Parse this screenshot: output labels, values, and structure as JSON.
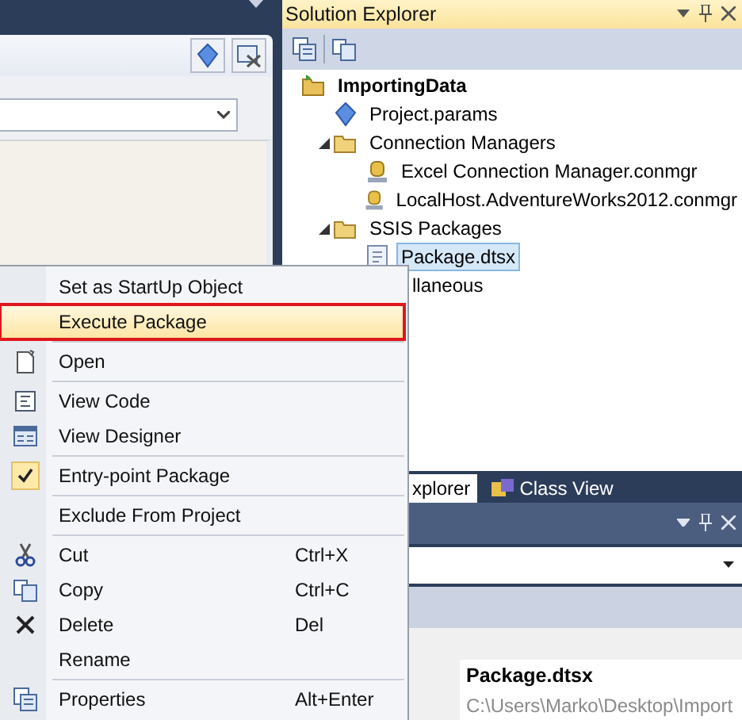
{
  "solution_explorer": {
    "title": "Solution Explorer",
    "tree": [
      {
        "label": "ImportingData",
        "kind": "project",
        "bold": true,
        "selected": false,
        "children": [
          {
            "label": "Project.params",
            "kind": "params",
            "selected": false
          },
          {
            "label": "Connection Managers",
            "kind": "folder",
            "expanded": true,
            "selected": false,
            "children": [
              {
                "label": "Excel Connection Manager.conmgr",
                "kind": "connection",
                "selected": false
              },
              {
                "label": "LocalHost.AdventureWorks2012.conmgr",
                "kind": "connection",
                "selected": false
              }
            ]
          },
          {
            "label": "SSIS Packages",
            "kind": "folder",
            "expanded": true,
            "selected": false,
            "children": [
              {
                "label": "Package.dtsx",
                "kind": "package",
                "selected": true
              }
            ]
          },
          {
            "label": "llaneous",
            "kind": "plain",
            "selected": false
          }
        ]
      }
    ]
  },
  "tabs": [
    {
      "label": "xplorer",
      "selected": true,
      "kind": "plain"
    },
    {
      "label": "Class View",
      "selected": false,
      "kind": "classview"
    }
  ],
  "properties": {
    "header": "Package.dtsx",
    "path": "C:\\Users\\Marko\\Desktop\\Import"
  },
  "context_menu": [
    {
      "label": "Set as StartUp Object",
      "kind": "plain",
      "selected": false,
      "outlined": false
    },
    {
      "label": "Execute Package",
      "kind": "plain",
      "selected": true,
      "outlined": true
    },
    {
      "kind": "separator"
    },
    {
      "label": "Open",
      "kind": "open",
      "selected": false,
      "outlined": false
    },
    {
      "kind": "separator"
    },
    {
      "label": "View Code",
      "kind": "code",
      "selected": false,
      "outlined": false
    },
    {
      "label": "View Designer",
      "kind": "designer",
      "selected": false,
      "outlined": false
    },
    {
      "kind": "separator"
    },
    {
      "label": "Entry-point Package",
      "kind": "check",
      "checked": true,
      "selected": false,
      "outlined": false
    },
    {
      "kind": "separator"
    },
    {
      "label": "Exclude From Project",
      "kind": "plain",
      "selected": false,
      "outlined": false
    },
    {
      "kind": "separator"
    },
    {
      "label": "Cut",
      "shortcut": "Ctrl+X",
      "kind": "cut",
      "selected": false,
      "outlined": false
    },
    {
      "label": "Copy",
      "shortcut": "Ctrl+C",
      "kind": "copy",
      "selected": false,
      "outlined": false
    },
    {
      "label": "Delete",
      "shortcut": "Del",
      "kind": "delete",
      "selected": false,
      "outlined": false
    },
    {
      "label": "Rename",
      "kind": "plain",
      "selected": false,
      "outlined": false
    },
    {
      "kind": "separator"
    },
    {
      "label": "Properties",
      "shortcut": "Alt+Enter",
      "kind": "properties",
      "selected": false,
      "outlined": false
    }
  ]
}
